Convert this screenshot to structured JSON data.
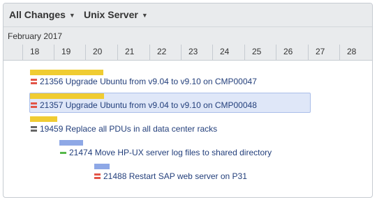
{
  "toolbar": {
    "changes_filter": "All Changes",
    "server_filter": "Unix Server"
  },
  "timeline": {
    "month": "February 2017",
    "days": [
      "18",
      "19",
      "20",
      "21",
      "22",
      "23",
      "24",
      "25",
      "26",
      "27",
      "28"
    ]
  },
  "tasks": [
    {
      "id": "21356",
      "title": "Upgrade Ubuntu from v9.04 to v9.10 on CMP00047",
      "label": "21356 Upgrade Ubuntu from v9.04 to v9.10 on CMP00047",
      "priority": "high",
      "bar_color": "yellow",
      "selected": false
    },
    {
      "id": "21357",
      "title": "Upgrade Ubuntu from v9.04 to v9.10 on CMP00048",
      "label": "21357 Upgrade Ubuntu from v9.04 to v9.10 on CMP00048",
      "priority": "high",
      "bar_color": "yellow",
      "selected": true
    },
    {
      "id": "19459",
      "title": "Replace all PDUs in all data center racks",
      "label": "19459 Replace all PDUs in all data center racks",
      "priority": "medium",
      "bar_color": "yellow",
      "selected": false
    },
    {
      "id": "21474",
      "title": "Move HP-UX server log files to shared directory",
      "label": "21474 Move HP-UX server log files to shared directory",
      "priority": "low",
      "bar_color": "blue",
      "selected": false
    },
    {
      "id": "21488",
      "title": "Restart SAP web server on P31",
      "label": "21488 Restart SAP web server on P31",
      "priority": "high",
      "bar_color": "blue",
      "selected": false
    }
  ],
  "colors": {
    "bar_yellow": "#f0cc32",
    "bar_blue": "#8ea8e6",
    "priority_high": "#e25548",
    "priority_medium": "#666666",
    "priority_low": "#56b84a",
    "task_text": "#233f7b",
    "selection": "#dfe7f8"
  }
}
